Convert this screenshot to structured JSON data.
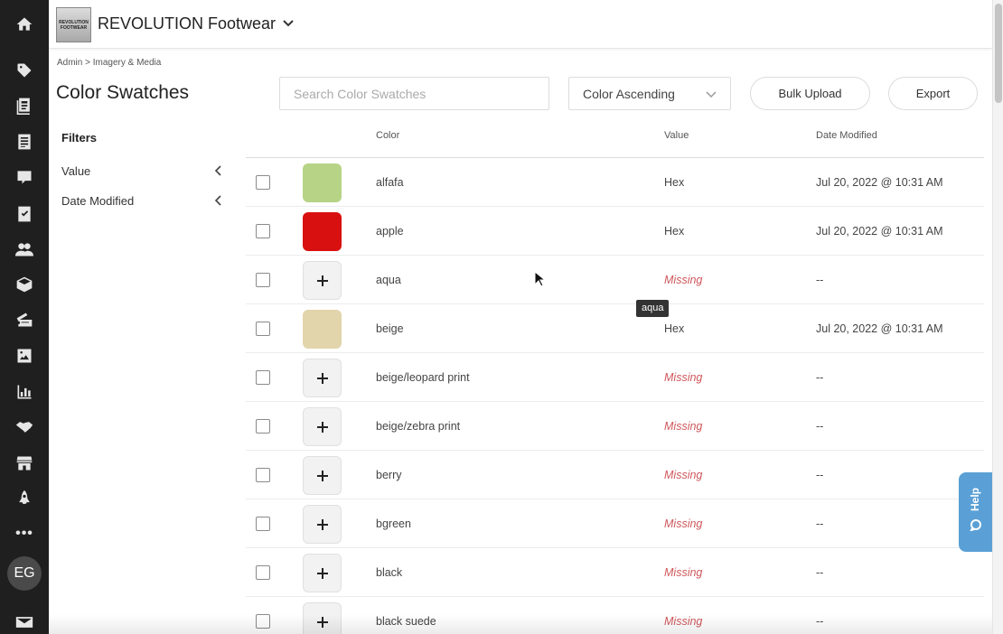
{
  "app": {
    "brand_logo_text": "REVOLUTION FOOTWEAR",
    "brand_name": "REVOLUTION Footwear",
    "user_initials": "EG"
  },
  "nav_icons": [
    "home-icon",
    "tag-icon",
    "catalog-icon",
    "document-list-icon",
    "bookmark-icon",
    "checklist-icon",
    "users-icon",
    "box-icon",
    "ticket-icon",
    "image-icon",
    "chart-icon",
    "handshake-icon",
    "store-icon",
    "rocket-icon",
    "more-icon",
    "mail-icon"
  ],
  "breadcrumb": "Admin > Imagery & Media",
  "page_title": "Color Swatches",
  "toolbar": {
    "search_placeholder": "Search Color Swatches",
    "sort_value": "Color Ascending",
    "bulk_upload": "Bulk Upload",
    "export": "Export"
  },
  "filters": {
    "title": "Filters",
    "items": [
      "Value",
      "Date Modified"
    ]
  },
  "table": {
    "headers": {
      "color": "Color",
      "value": "Value",
      "date": "Date Modified"
    },
    "rows": [
      {
        "color": "alfafa",
        "swatch": "#b7d486",
        "value": "Hex",
        "missing": false,
        "date": "Jul 20, 2022 @ 10:31 AM"
      },
      {
        "color": "apple",
        "swatch": "#d91010",
        "value": "Hex",
        "missing": false,
        "date": "Jul 20, 2022 @ 10:31 AM"
      },
      {
        "color": "aqua",
        "swatch": null,
        "value": "Missing",
        "missing": true,
        "date": "--"
      },
      {
        "color": "beige",
        "swatch": "#e2d4ab",
        "value": "Hex",
        "missing": false,
        "date": "Jul 20, 2022 @ 10:31 AM"
      },
      {
        "color": "beige/leopard print",
        "swatch": null,
        "value": "Missing",
        "missing": true,
        "date": "--"
      },
      {
        "color": "beige/zebra print",
        "swatch": null,
        "value": "Missing",
        "missing": true,
        "date": "--"
      },
      {
        "color": "berry",
        "swatch": null,
        "value": "Missing",
        "missing": true,
        "date": "--"
      },
      {
        "color": "bgreen",
        "swatch": null,
        "value": "Missing",
        "missing": true,
        "date": "--"
      },
      {
        "color": "black",
        "swatch": null,
        "value": "Missing",
        "missing": true,
        "date": "--"
      },
      {
        "color": "black suede",
        "swatch": null,
        "value": "Missing",
        "missing": true,
        "date": "--"
      }
    ]
  },
  "tooltip": "aqua",
  "help_label": "Help"
}
